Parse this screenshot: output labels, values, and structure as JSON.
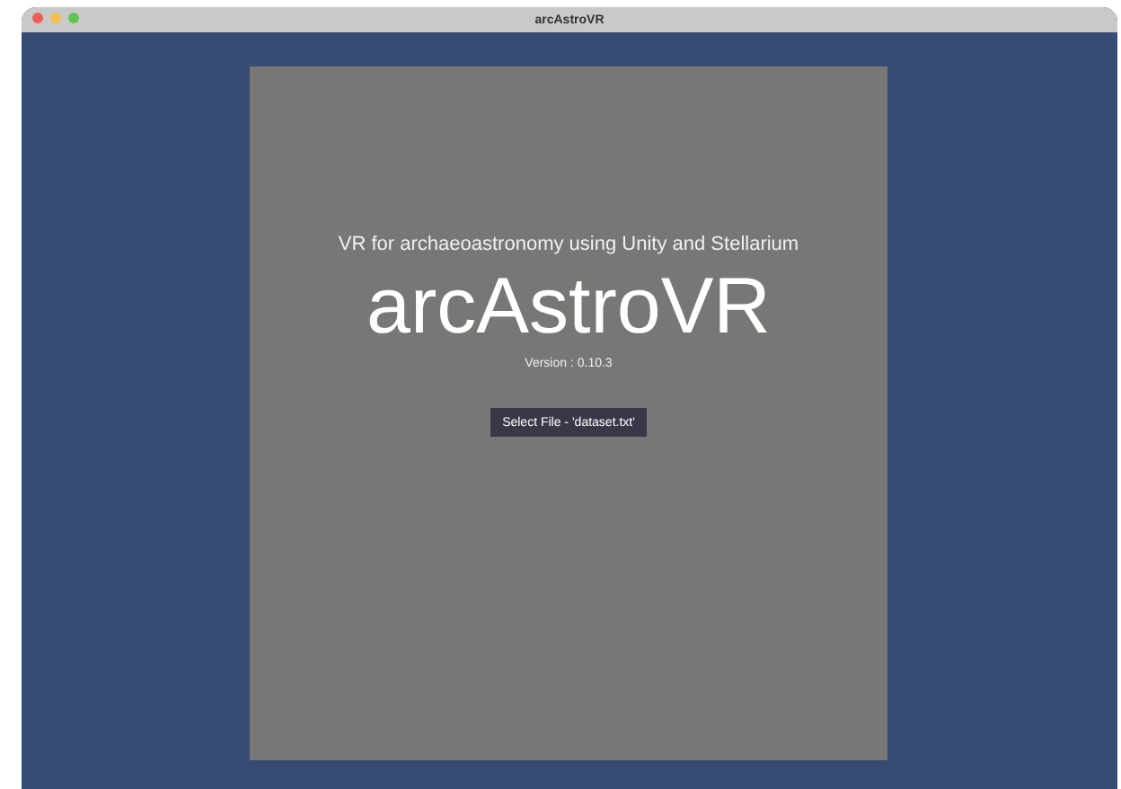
{
  "window": {
    "title": "arcAstroVR"
  },
  "splash": {
    "subtitle": "VR for archaeoastronomy using Unity and Stellarium",
    "title": "arcAstroVR",
    "version": "Version : 0.10.3",
    "button": "Select File - 'dataset.txt'"
  }
}
